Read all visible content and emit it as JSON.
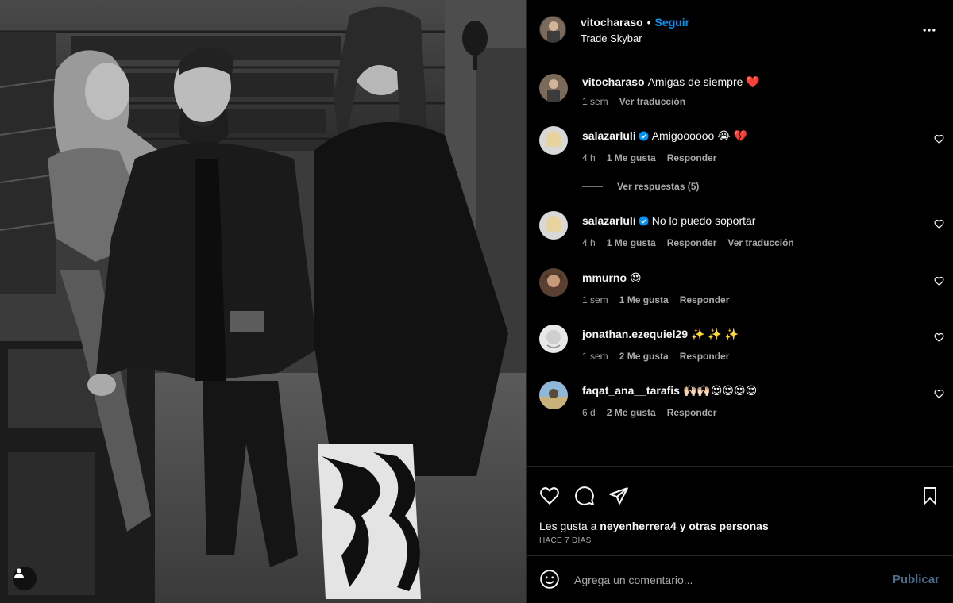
{
  "post": {
    "author": "vitocharaso",
    "follow_label": "Seguir",
    "location": "Trade Skybar",
    "caption_user": "vitocharaso",
    "caption_text": "Amigas de siempre ❤️",
    "caption_time": "1 sem",
    "caption_translate": "Ver traducción"
  },
  "comments": [
    {
      "user": "salazarluli",
      "verified": true,
      "text": "Amigoooooo 😭 💔",
      "time": "4 h",
      "likes": "1 Me gusta",
      "reply": "Responder",
      "translate": ""
    },
    {
      "user": "salazarluli",
      "verified": true,
      "text": "No lo puedo soportar",
      "time": "4 h",
      "likes": "1 Me gusta",
      "reply": "Responder",
      "translate": "Ver traducción"
    },
    {
      "user": "mmurno",
      "verified": false,
      "text": "😍",
      "time": "1 sem",
      "likes": "1 Me gusta",
      "reply": "Responder",
      "translate": ""
    },
    {
      "user": "jonathan.ezequiel29",
      "verified": false,
      "text": "✨ ✨ ✨",
      "time": "1 sem",
      "likes": "2 Me gusta",
      "reply": "Responder",
      "translate": ""
    },
    {
      "user": "faqat_ana__tarafis",
      "verified": false,
      "text": "🙌🏻🙌🏻😍😍😍😍",
      "time": "6 d",
      "likes": "2 Me gusta",
      "reply": "Responder",
      "translate": ""
    }
  ],
  "view_replies": "Ver respuestas (5)",
  "likes_line": {
    "prefix": "Les gusta a",
    "user": "neyenherrera4",
    "middle": "y",
    "others": "otras personas"
  },
  "posted_ago": "HACE 7 DÍAS",
  "comment_box": {
    "placeholder": "Agrega un comentario...",
    "publish": "Publicar"
  },
  "icons": {
    "more": "more-horizontal-icon",
    "like": "heart-icon",
    "comment": "comment-bubble-icon",
    "share": "send-icon",
    "save": "bookmark-icon",
    "emoji": "emoji-icon",
    "verified": "verified-badge-icon",
    "tag": "user-tag-icon"
  },
  "colors": {
    "follow": "#0095f6",
    "verified": "#0095f6",
    "heart": "#ed4956",
    "publish_disabled": "#4a6d8c"
  }
}
